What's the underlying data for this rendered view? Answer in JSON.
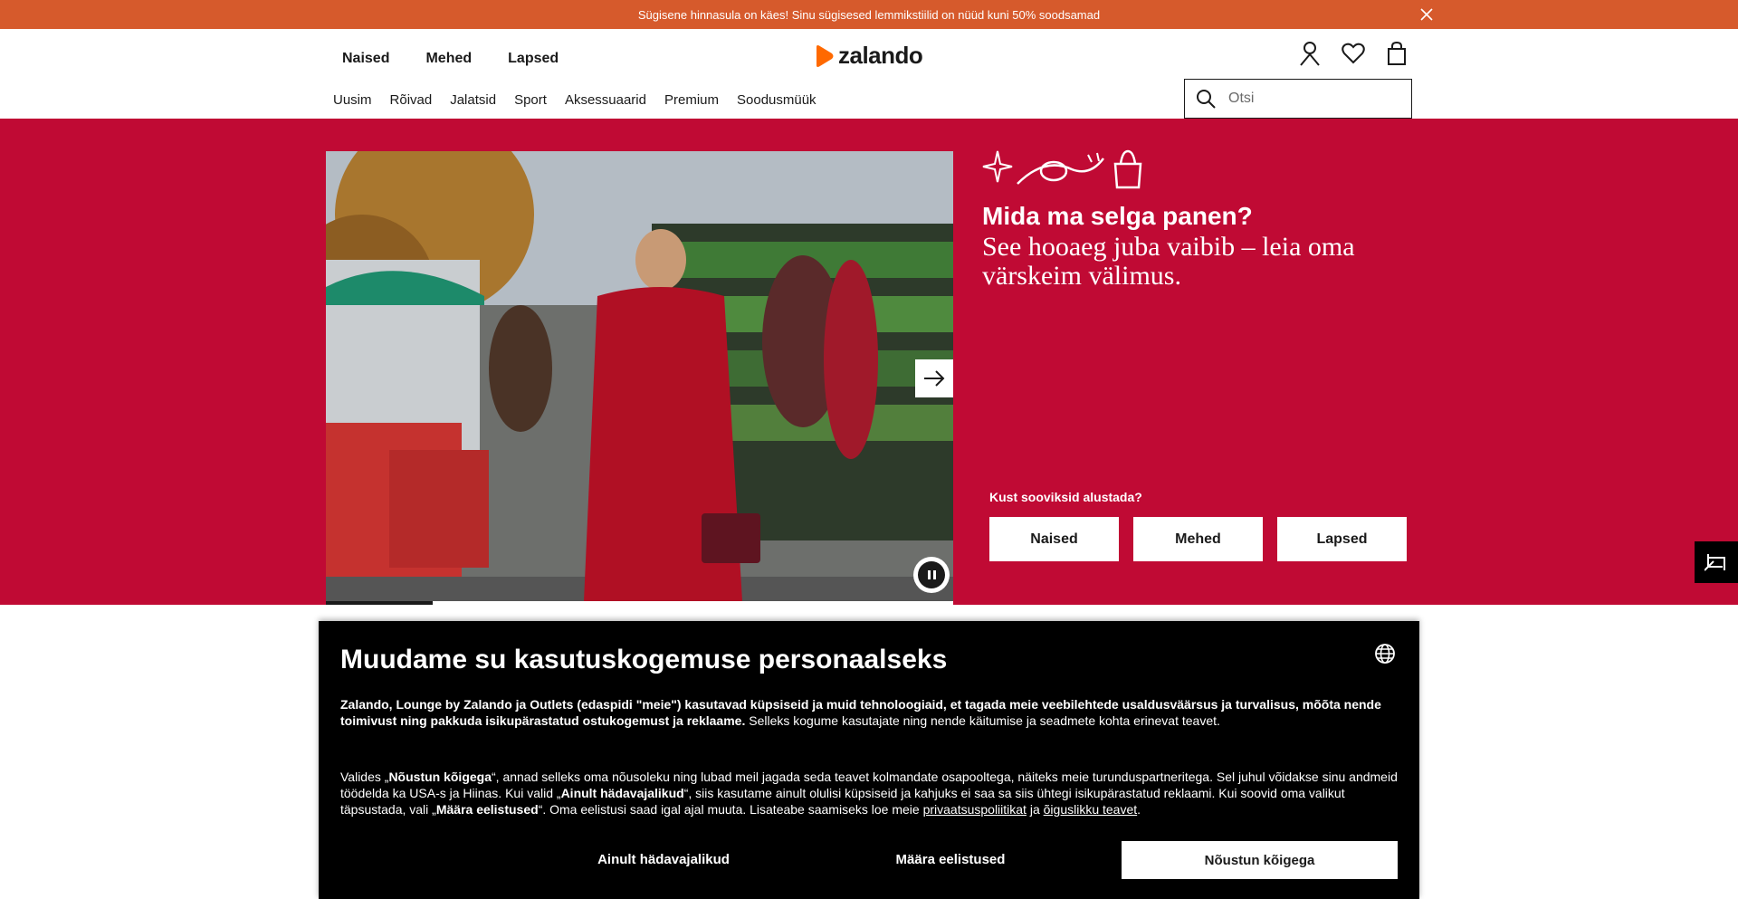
{
  "promo": {
    "text": "Sügisene hinnasula on käes! Sinu sügisesed lemmikstiilid on nüüd kuni 50% soodsamad"
  },
  "header": {
    "gender_tabs": [
      "Naised",
      "Mehed",
      "Lapsed"
    ],
    "logo_text": "zalando",
    "brand_color": "#ff6900",
    "categories": [
      "Uusim",
      "Rõivad",
      "Jalatsid",
      "Sport",
      "Aksessuaarid",
      "Premium",
      "Soodusmüük"
    ],
    "search_placeholder": "Otsi",
    "icons": [
      "user-icon",
      "heart-icon",
      "bag-icon"
    ]
  },
  "hero": {
    "background_color": "#c00a34",
    "title": "Mida ma selga panen?",
    "subtitle": "See hooaeg juba vaibib – leia oma värskeim välimus.",
    "prompt": "Kust sooviksid alustada?",
    "buttons": [
      "Naised",
      "Mehed",
      "Lapsed"
    ],
    "slide_progress": 0.17
  },
  "consent": {
    "title": "Muudame su kasutuskogemuse personaalseks",
    "p1_bold": "Zalando, Lounge by Zalando ja Outlets (edaspidi \"meie\") kasutavad küpsiseid ja muid tehnoloogiaid, et tagada meie veebilehtede usaldusväärsus ja turvalisus, mõõta nende toimivust ning pakkuda isikupärastatud ostukogemust ja reklaame.",
    "p1_rest": " Selleks kogume kasutajate ning nende käitumise ja seadmete kohta erinevat teavet.",
    "p2_a": "Valides „",
    "p2_b1": "Nõustun kõigega",
    "p2_c": "“, annad selleks oma nõusoleku ning lubad meil jagada seda teavet kolmandate osapooltega, näiteks meie turunduspartneritega. Sel juhul võidakse sinu andmeid töödelda ka USA-s ja Hiinas. Kui valid „",
    "p2_b2": "Ainult hädavajalikud",
    "p2_d": "“, siis kasutame ainult olulisi küpsiseid ja kahjuks ei saa sa siis ühtegi isikupärastatud reklaami. Kui soovid oma valikut täpsustada, vali „",
    "p2_b3": "Määra eelistused",
    "p2_e": "“. Oma eelistusi saad igal ajal muuta. Lisateabe saamiseks loe meie ",
    "link_privacy": "privaatsuspoliitikat",
    "p2_f": " ja ",
    "link_legal": "õiguslikku teavet",
    "p2_g": ".",
    "btn_essential": "Ainult hädavajalikud",
    "btn_preferences": "Määra eelistused",
    "btn_accept": "Nõustun kõigega"
  }
}
